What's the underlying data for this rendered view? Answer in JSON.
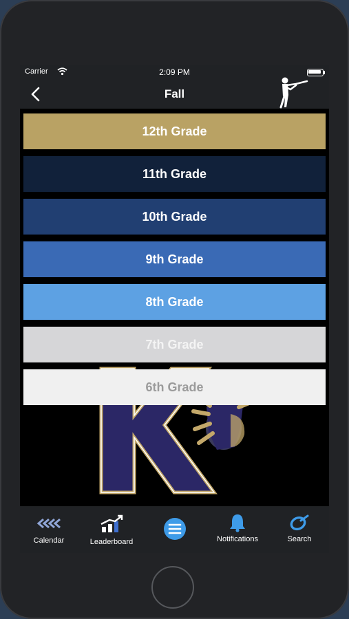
{
  "status_bar": {
    "carrier": "Carrier",
    "time": "2:09 PM"
  },
  "nav": {
    "title": "Fall"
  },
  "grades": [
    {
      "label": "12th Grade",
      "bg": "#b9a264",
      "color": "#ffffff"
    },
    {
      "label": "11th Grade",
      "bg": "#11213a",
      "color": "#ffffff"
    },
    {
      "label": "10th Grade",
      "bg": "#213f72",
      "color": "#ffffff"
    },
    {
      "label": "9th Grade",
      "bg": "#3a6ab5",
      "color": "#ffffff"
    },
    {
      "label": "8th Grade",
      "bg": "#5da1e3",
      "color": "#ffffff"
    },
    {
      "label": "7th Grade",
      "bg": "#d6d6d8",
      "color": "#f4f4f4"
    },
    {
      "label": "6th Grade",
      "bg": "#f0f0f0",
      "color": "#9b9b9b"
    }
  ],
  "tabs": [
    {
      "label": "Calendar",
      "icon": "chevrons-left-icon"
    },
    {
      "label": "Leaderboard",
      "icon": "rising-bars-icon"
    },
    {
      "label": "",
      "icon": "menu-icon"
    },
    {
      "label": "Notifications",
      "icon": "bell-icon"
    },
    {
      "label": "Search",
      "icon": "target-icon"
    }
  ],
  "colors": {
    "navy": "#2b2766",
    "gold": "#c3a86a",
    "accent_blue": "#3e9be8"
  }
}
